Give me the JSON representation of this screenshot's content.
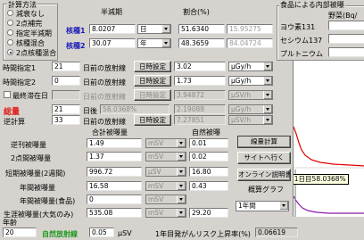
{
  "calc_method": {
    "title": "計算方法",
    "options": [
      "減衰なし",
      "2点補完",
      "指定半減期",
      "核種混合",
      "2点核種混合"
    ],
    "selected_index": 4
  },
  "nuclide_header": {
    "halflife": "半減期",
    "ratio": "割合(%)"
  },
  "nuclide1": {
    "label": "核種1",
    "halflife": "8.0207",
    "unit": "日",
    "ratio": "51.6340",
    "ratio2": "15.95275"
  },
  "nuclide2": {
    "label": "核種2",
    "halflife": "30.07",
    "unit": "年",
    "ratio": "48.3659",
    "ratio2": "84.04724"
  },
  "internal": {
    "title": "食品による内部被曝",
    "veg_label": "野菜(Bq/",
    "iodine": "ヨウ素131",
    "cesium": "セシウム137",
    "plutonium": "プルトニウム"
  },
  "time1": {
    "label": "時間指定1",
    "value": "21",
    "suffix": "日前の放射線",
    "button": "日時設定",
    "dose": "3.02",
    "unit": "μGy/h"
  },
  "time2": {
    "label": "時間指定2",
    "value": "0",
    "suffix": "日前の放射線",
    "button": "日時設定",
    "dose": "1.73",
    "unit": "μGy/h"
  },
  "last_stay": {
    "label": "最終滞在日",
    "suffix": "日前の放射線",
    "button": "日時設定",
    "dose": "3.94872",
    "unit": "μSV/h"
  },
  "total": {
    "label": "総量",
    "value": "21",
    "suffix": "日後",
    "pct": "58.0368%",
    "dose": "2.19088",
    "unit": "μGy/h"
  },
  "reverse": {
    "label": "逆計算",
    "value": "33",
    "suffix": "日前の放射線",
    "button": "日時設定",
    "dose": "7.27851",
    "unit": "μSV/h"
  },
  "cols": {
    "total": "合計被曝量",
    "natural": "自然被曝"
  },
  "rows": [
    {
      "label": "逆刊被曝量",
      "total": "1.49",
      "unit": "mSV",
      "natural": "0.01"
    },
    {
      "label": "2点間被曝量",
      "total": "1.37",
      "unit": "mSV",
      "natural": "0.02"
    },
    {
      "label": "短期被曝量(2週間)",
      "total": "996.72",
      "unit": "μSV",
      "natural": "16.80"
    },
    {
      "label": "年間被曝量",
      "total": "16.58",
      "unit": "mSV",
      "natural": "0.43"
    },
    {
      "label": "年間被曝量(食品)",
      "total": "0",
      "unit": "mSV",
      "natural": ""
    },
    {
      "label": "生涯被曝量(大気のみ)",
      "total": "535.08",
      "unit": "mSV",
      "natural": "29.20"
    }
  ],
  "buttons": {
    "calc": "線量計算",
    "site": "サイトへ行く",
    "manual": "オンライン説明書"
  },
  "graph": {
    "label": "概算グラフ",
    "period": "1年間",
    "tooltip": "21日目58.0368%"
  },
  "age": {
    "label": "年齢",
    "value": "20"
  },
  "natural_rad": {
    "label": "自然放射線",
    "value": "0.05",
    "unit": "μSV"
  },
  "cancer": {
    "label": "1年目発がんリスク上昇率(%)",
    "value": "0.06619"
  },
  "colors": {
    "nuclide": "#1a1ab8",
    "total": "#e0201e",
    "natural": "#1f9a1f",
    "curve_red": "#e00000",
    "curve_purple": "#8a1aa8"
  }
}
